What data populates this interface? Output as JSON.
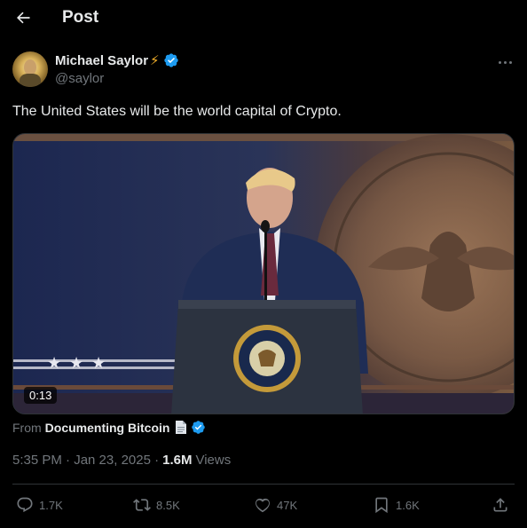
{
  "header": {
    "title": "Post"
  },
  "author": {
    "display_name": "Michael Saylor",
    "handle": "@saylor"
  },
  "post": {
    "text": "The United States will be the world capital of Crypto."
  },
  "media": {
    "duration": "0:13"
  },
  "source": {
    "from_label": "From",
    "name": "Documenting Bitcoin"
  },
  "meta": {
    "timestamp": "5:35 PM · Jan 23, 2025 ·",
    "views_count": "1.6M",
    "views_label": "Views"
  },
  "actions": {
    "replies": "1.7K",
    "reposts": "8.5K",
    "likes": "47K",
    "bookmarks": "1.6K"
  },
  "colors": {
    "accent": "#1d9bf0",
    "muted": "#71767b",
    "text": "#e7e9ea",
    "background": "#000000"
  }
}
